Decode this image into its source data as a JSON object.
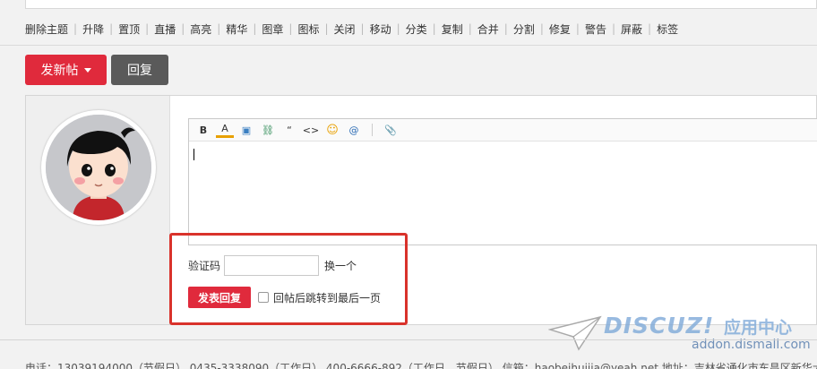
{
  "moderation": {
    "items": [
      "删除主题",
      "升降",
      "置顶",
      "直播",
      "高亮",
      "精华",
      "图章",
      "图标",
      "关闭",
      "移动",
      "分类",
      "复制",
      "合并",
      "分割",
      "修复",
      "警告",
      "屏蔽",
      "标签"
    ]
  },
  "actions": {
    "new_post_label": "发新帖",
    "reply_label": "回复"
  },
  "editor": {
    "toolbar": [
      {
        "icon": "bold-icon",
        "glyph": "B"
      },
      {
        "icon": "font-color-icon",
        "glyph": "A"
      },
      {
        "icon": "image-icon",
        "glyph": "▣"
      },
      {
        "icon": "link-icon",
        "glyph": "⛓"
      },
      {
        "icon": "quote-icon",
        "glyph": "“"
      },
      {
        "icon": "code-icon",
        "glyph": "<>"
      },
      {
        "icon": "smiley-icon",
        "glyph": "☺"
      },
      {
        "icon": "at-icon",
        "glyph": "@"
      },
      {
        "icon": "attachment-icon",
        "glyph": "📎"
      }
    ]
  },
  "captcha": {
    "label": "验证码",
    "value": "",
    "swap_label": "换一个"
  },
  "submit": {
    "label": "发表回复",
    "jump_label": "回帖后跳转到最后一页",
    "jump_checked": false
  },
  "footer": {
    "text": "电话：13039194000（节假日）  0435-3338090（工作日）  400-6666-892（工作日，节假日）    信箱：haobeihuijia@yeah.net     地址：吉林省通化市东昌区新华大街"
  },
  "watermark": {
    "brand": "DISCUZ!",
    "cn": "应用中心",
    "url": "addon.dismall.com"
  },
  "colors": {
    "accent_red": "#e02a3c",
    "reply_gray": "#5a5a5a",
    "highlight_red": "#d9322b"
  }
}
